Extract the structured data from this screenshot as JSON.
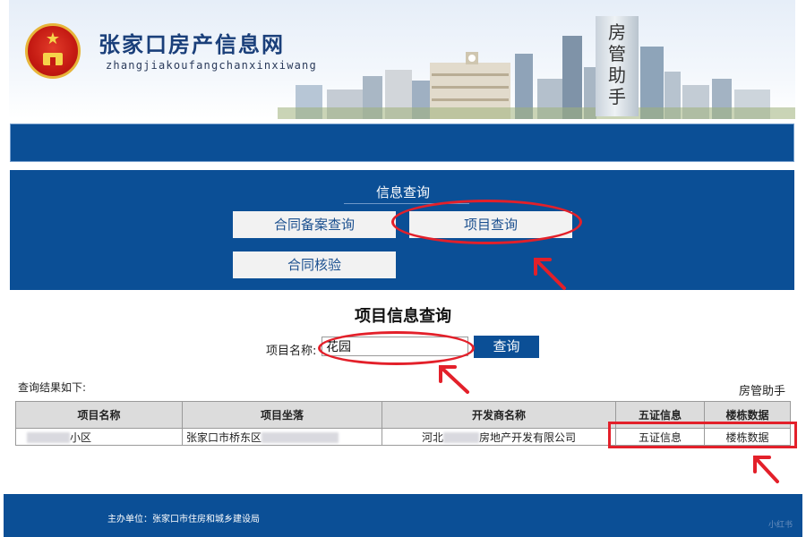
{
  "header": {
    "site_title": "张家口房产信息网",
    "site_pinyin": "zhangjiakoufangchanxinxiwang",
    "tower_text": "房管助手"
  },
  "query_panel": {
    "title": "信息查询",
    "buttons": [
      "合同备案查询",
      "项目查询",
      "合同核验"
    ]
  },
  "search": {
    "title": "项目信息查询",
    "label": "项目名称:",
    "input_value": "花园",
    "button_label": "查询"
  },
  "results": {
    "label": "查询结果如下:",
    "watermark": "房管助手",
    "columns": [
      "项目名称",
      "项目坐落",
      "开发商名称",
      "五证信息",
      "楼栋数据"
    ],
    "rows": [
      {
        "name_suffix": "小区",
        "location_prefix": "张家口市桥东区",
        "developer_prefix": "河北",
        "developer_suffix": "房地产开发有限公司",
        "certs": "五证信息",
        "buildings": "楼栋数据"
      }
    ]
  },
  "footer": {
    "text": "主办单位：张家口市住房和城乡建设局",
    "badge": "小红书"
  },
  "colors": {
    "primary_blue": "#0b4f96",
    "annotation_red": "#e3202a",
    "title_blue": "#1a3f7a"
  }
}
